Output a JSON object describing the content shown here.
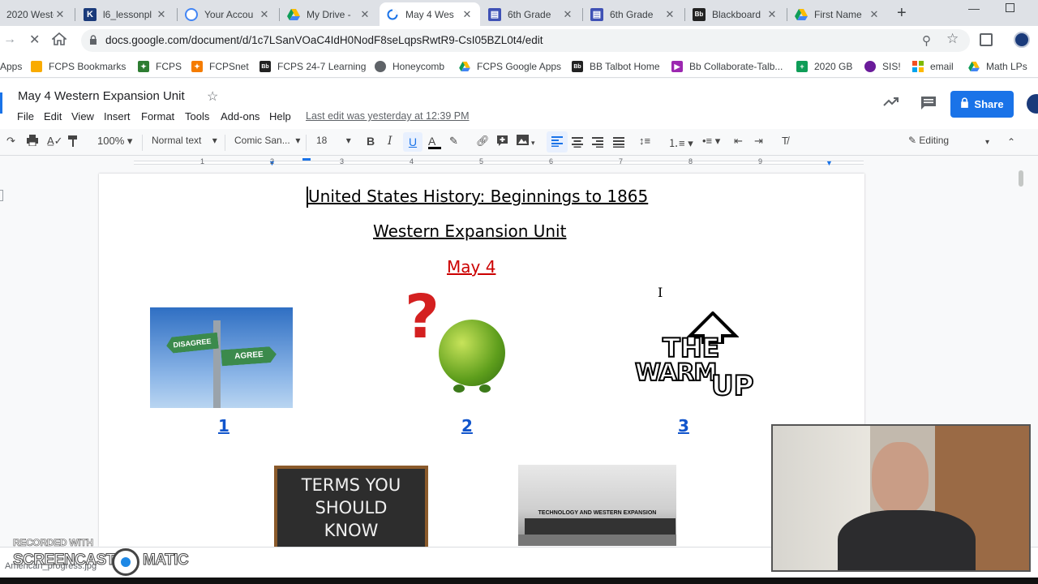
{
  "browser": {
    "tabs": [
      {
        "title": "2020 Weste",
        "icon": "google-drive-icon"
      },
      {
        "title": "l6_lessonpl",
        "icon": "k-icon"
      },
      {
        "title": "Your Accou",
        "icon": "account-icon"
      },
      {
        "title": "My Drive -",
        "icon": "google-drive-icon"
      },
      {
        "title": "May 4 Wes",
        "icon": "loading-icon",
        "active": true
      },
      {
        "title": "6th Grade",
        "icon": "google-forms-icon"
      },
      {
        "title": "6th Grade",
        "icon": "google-forms-icon"
      },
      {
        "title": "Blackboard",
        "icon": "blackboard-icon"
      },
      {
        "title": "First Name",
        "icon": "google-drive-icon"
      }
    ],
    "new_tab": "+",
    "url": "docs.google.com/document/d/1c7LSanVOaC4IdH0NodF8seLqpsRwtR9-CsI05BZL0t4/edit",
    "bookmarks": [
      {
        "label": "Apps",
        "icon": "apps-grid-icon"
      },
      {
        "label": "FCPS Bookmarks",
        "icon": "folder-icon"
      },
      {
        "label": "FCPS",
        "icon": "fcps-icon"
      },
      {
        "label": "FCPSnet",
        "icon": "fcps-icon"
      },
      {
        "label": "FCPS 24-7 Learning",
        "icon": "blackboard-icon"
      },
      {
        "label": "Honeycomb",
        "icon": "globe-icon"
      },
      {
        "label": "FCPS Google Apps",
        "icon": "google-drive-icon"
      },
      {
        "label": "BB Talbot Home",
        "icon": "blackboard-icon"
      },
      {
        "label": "Bb Collaborate-Talb...",
        "icon": "collaborate-icon"
      },
      {
        "label": "2020 GB",
        "icon": "sheets-icon"
      },
      {
        "label": "SIS!",
        "icon": "sis-icon"
      },
      {
        "label": "email",
        "icon": "microsoft-icon"
      },
      {
        "label": "Math LPs",
        "icon": "google-drive-icon"
      }
    ]
  },
  "docs": {
    "title": "May 4 Western Expansion Unit",
    "menu": [
      "File",
      "Edit",
      "View",
      "Insert",
      "Format",
      "Tools",
      "Add-ons",
      "Help"
    ],
    "last_edit": "Last edit was yesterday at 12:39 PM",
    "share_label": "Share",
    "zoom": "100%",
    "style": "Normal text",
    "font": "Comic San...",
    "font_size": "18",
    "mode": "Editing",
    "ruler_numbers": [
      "1",
      "1",
      "2",
      "3",
      "4",
      "5",
      "6",
      "7",
      "8",
      "9"
    ]
  },
  "document": {
    "title_line": "United States History: Beginnings to 1865",
    "subtitle_line": "Western Expansion Unit",
    "date_line": "May 4",
    "link1": "1",
    "link2": "2",
    "link3": "3",
    "img1_sign_left": "DISAGREE",
    "img1_sign_right": "AGREE",
    "img3_text_top": "THE",
    "img3_text_bottom": "WARM",
    "img3_text_up": "UP",
    "img4_line1": "TERMS YOU",
    "img4_line2": "SHOULD",
    "img4_line3": "KNOW",
    "img5_caption": "TECHNOLOGY AND WESTERN EXPANSION"
  },
  "overlay": {
    "recorded_with": "RECORDED WITH",
    "brand_left": "SCREENCAST",
    "brand_right": "MATIC",
    "download_file": "American_progress.jpg"
  },
  "colors": {
    "date_red": "#cc0000",
    "link_blue": "#1155cc",
    "share_blue": "#1a73e8"
  }
}
